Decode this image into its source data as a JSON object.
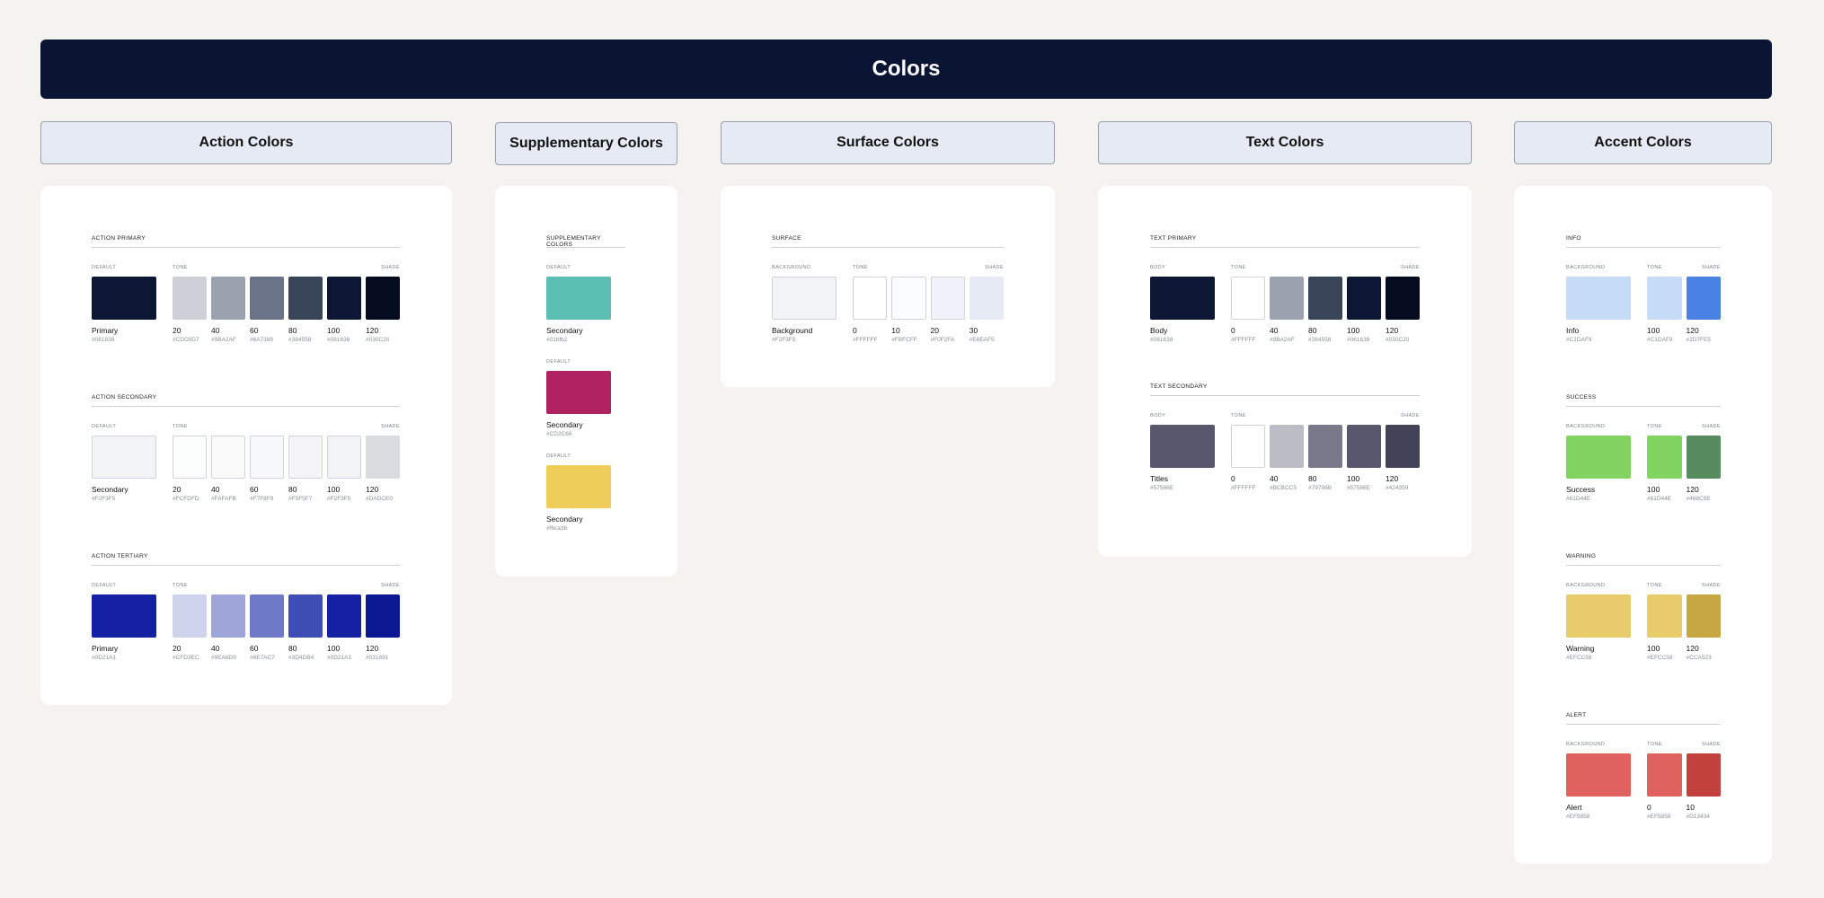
{
  "page_title": "Colors",
  "headers": {
    "action": "Action Colors",
    "supplementary": "Supplementary Colors",
    "surface": "Surface Colors",
    "text": "Text Colors",
    "accent": "Accent Colors"
  },
  "action": {
    "primary": {
      "title": "ACTION PRIMARY",
      "default_label": "DEFAULT",
      "tone_label": "TONE",
      "shade_label": "SHADE",
      "default": {
        "name": "Primary",
        "hex": "#081838",
        "color": "#0b1733"
      },
      "swatches": [
        {
          "name": "20",
          "hex": "#CDD0D7",
          "color": "#cdd0d7"
        },
        {
          "name": "40",
          "hex": "#9BA2AF",
          "color": "#9ba2af"
        },
        {
          "name": "60",
          "hex": "#6A7388",
          "color": "#6a7388"
        },
        {
          "name": "80",
          "hex": "#384558",
          "color": "#384558"
        },
        {
          "name": "100",
          "hex": "#081636",
          "color": "#0b1733"
        },
        {
          "name": "120",
          "hex": "#030C20",
          "color": "#060c20"
        }
      ]
    },
    "secondary": {
      "title": "ACTION SECONDARY",
      "default_label": "DEFAULT",
      "tone_label": "TONE",
      "shade_label": "SHADE",
      "default": {
        "name": "Secondary",
        "hex": "#F2F3F5",
        "color": "#f2f3f5"
      },
      "swatches": [
        {
          "name": "20",
          "hex": "#FCFDFD",
          "color": "#fcfdfd"
        },
        {
          "name": "40",
          "hex": "#FAFAFB",
          "color": "#fafafb"
        },
        {
          "name": "60",
          "hex": "#F7F8F9",
          "color": "#f7f8f9"
        },
        {
          "name": "80",
          "hex": "#F5F5F7",
          "color": "#f5f5f7"
        },
        {
          "name": "100",
          "hex": "#F2F3F5",
          "color": "#f2f3f5"
        },
        {
          "name": "120",
          "hex": "#DADCE0",
          "color": "#dadce0"
        }
      ]
    },
    "tertiary": {
      "title": "ACTION TERTIARY",
      "default_label": "DEFAULT",
      "tone_label": "TONE",
      "shade_label": "SHADE",
      "default": {
        "name": "Primary",
        "hex": "#0D21A1",
        "color": "#1421a2"
      },
      "swatches": [
        {
          "name": "20",
          "hex": "#CFD3EC",
          "color": "#cfd3ec"
        },
        {
          "name": "40",
          "hex": "#9EA6D9",
          "color": "#9ea6d9"
        },
        {
          "name": "60",
          "hex": "#6E7AC7",
          "color": "#6e7ac7"
        },
        {
          "name": "80",
          "hex": "#3D4DB4",
          "color": "#3d4db4"
        },
        {
          "name": "100",
          "hex": "#0D21A1",
          "color": "#1421a2"
        },
        {
          "name": "120",
          "hex": "#031691",
          "color": "#0a1891"
        }
      ]
    }
  },
  "supplementary": {
    "title": "SUPPLEMENTARY COLORS",
    "items": [
      {
        "label": "DEFAULT",
        "name": "Secondary",
        "hex": "#01bfb2",
        "color": "#5abfb2"
      },
      {
        "label": "DEFAULT",
        "name": "Secondary",
        "hex": "#CD2C66",
        "color": "#b12260"
      },
      {
        "label": "DEFAULT",
        "name": "Secondary",
        "hex": "#f6ca3b",
        "color": "#efcd5a"
      }
    ]
  },
  "surface": {
    "title": "SURFACE",
    "default_label": "BACKGROUND",
    "tone_label": "TONE",
    "shade_label": "SHADE",
    "default": {
      "name": "Background",
      "hex": "#F2F3F5",
      "color": "#f2f3f5"
    },
    "swatches": [
      {
        "name": "0",
        "hex": "#FFFFFF",
        "color": "#ffffff"
      },
      {
        "name": "10",
        "hex": "#FBFCFF",
        "color": "#fbfcff"
      },
      {
        "name": "20",
        "hex": "#F0F2FA",
        "color": "#f0f2fa"
      },
      {
        "name": "30",
        "hex": "#E6EAF5",
        "color": "#e6eaf5"
      }
    ]
  },
  "text": {
    "primary": {
      "title": "TEXT PRIMARY",
      "default_label": "BODY",
      "tone_label": "TONE",
      "shade_label": "SHADE",
      "default": {
        "name": "Body",
        "hex": "#081638",
        "color": "#0b1733"
      },
      "swatches": [
        {
          "name": "0",
          "hex": "#FFFFFF",
          "color": "#ffffff"
        },
        {
          "name": "40",
          "hex": "#9BA2AF",
          "color": "#9ba2af"
        },
        {
          "name": "80",
          "hex": "#384558",
          "color": "#384558"
        },
        {
          "name": "100",
          "hex": "#061638",
          "color": "#0b1733"
        },
        {
          "name": "120",
          "hex": "#030C20",
          "color": "#060c20"
        }
      ]
    },
    "secondary": {
      "title": "TEXT SECONDARY",
      "default_label": "BODY",
      "tone_label": "TONE",
      "shade_label": "SHADE",
      "default": {
        "name": "Titles",
        "hex": "#57586E",
        "color": "#57586e"
      },
      "swatches": [
        {
          "name": "0",
          "hex": "#FFFFFF",
          "color": "#ffffff"
        },
        {
          "name": "40",
          "hex": "#BCBCC5",
          "color": "#bcbcc5"
        },
        {
          "name": "80",
          "hex": "#79798B",
          "color": "#79798b"
        },
        {
          "name": "100",
          "hex": "#57586E",
          "color": "#57586e"
        },
        {
          "name": "120",
          "hex": "#424359",
          "color": "#424359"
        }
      ]
    }
  },
  "accent": {
    "info": {
      "title": "INFO",
      "default_label": "BACKGROUND",
      "tone_label": "TONE",
      "shade_label": "SHADE",
      "default": {
        "name": "Info",
        "hex": "#C1DAF9",
        "color": "#c6dbf7"
      },
      "swatches": [
        {
          "name": "100",
          "hex": "#C1DAF9",
          "color": "#c6dbf7"
        },
        {
          "name": "120",
          "hex": "#2D7FE5",
          "color": "#4a82e4"
        }
      ]
    },
    "success": {
      "title": "SUCCESS",
      "default_label": "BACKGROUND",
      "tone_label": "TONE",
      "shade_label": "SHADE",
      "default": {
        "name": "Success",
        "hex": "#61D44E",
        "color": "#82d461"
      },
      "swatches": [
        {
          "name": "100",
          "hex": "#61D44E",
          "color": "#82d461"
        },
        {
          "name": "120",
          "hex": "#468C5E",
          "color": "#578c5e"
        }
      ]
    },
    "warning": {
      "title": "WARNING",
      "default_label": "BACKGROUND",
      "tone_label": "TONE",
      "shade_label": "SHADE",
      "default": {
        "name": "Warning",
        "hex": "#EFCC58",
        "color": "#e8cb6a"
      },
      "swatches": [
        {
          "name": "100",
          "hex": "#EFCC58",
          "color": "#e8cb6a"
        },
        {
          "name": "120",
          "hex": "#CCA523",
          "color": "#c6a744"
        }
      ]
    },
    "alert": {
      "title": "ALERT",
      "default_label": "BACKGROUND",
      "tone_label": "TONE",
      "shade_label": "SHADE",
      "default": {
        "name": "Alert",
        "hex": "#EF5858",
        "color": "#e0625e"
      },
      "swatches": [
        {
          "name": "0",
          "hex": "#EF5858",
          "color": "#e0625e"
        },
        {
          "name": "10",
          "hex": "#D13434",
          "color": "#c2413c"
        }
      ]
    }
  }
}
